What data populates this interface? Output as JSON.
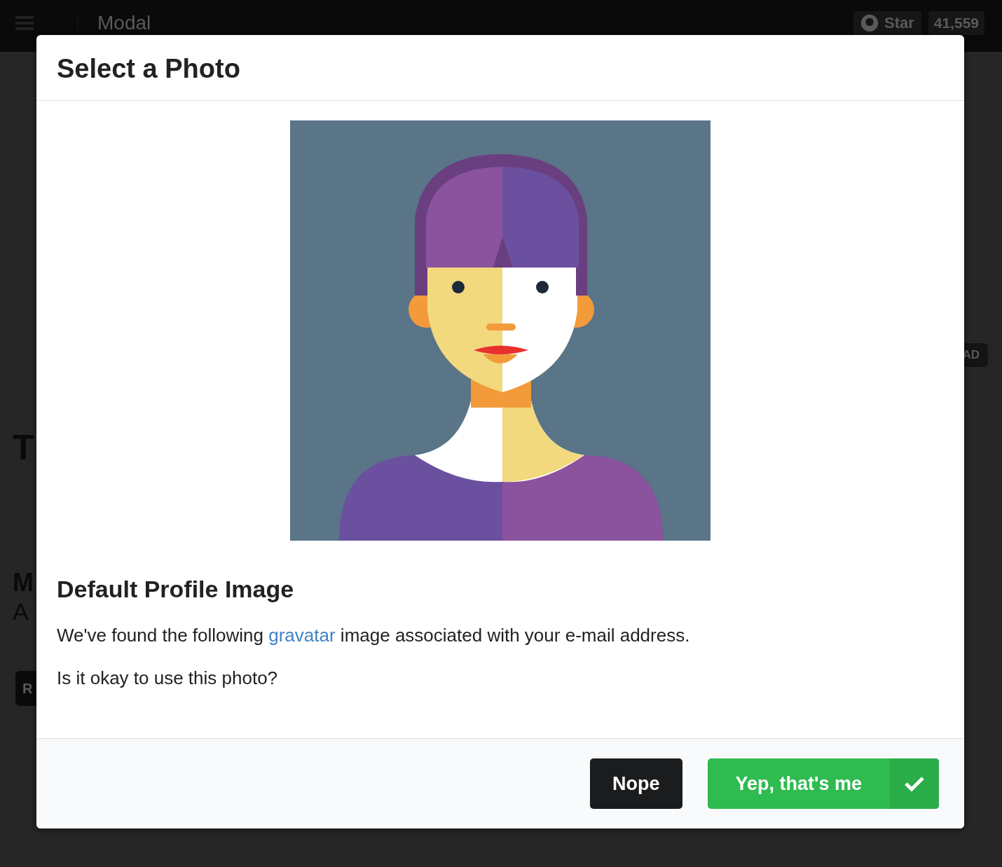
{
  "topbar": {
    "title": "Modal",
    "star_button": "Star",
    "star_count": "41,559"
  },
  "background": {
    "left_letters": [
      "T",
      "M",
      "A"
    ],
    "left_button": "R",
    "right_button": "AD"
  },
  "modal": {
    "title": "Select a Photo",
    "heading": "Default Profile Image",
    "description_before": "We've found the following",
    "link": "gravatar",
    "description_after": "image associated with your e-mail address.",
    "question": "Is it okay to use this photo?",
    "buttons": [
      {
        "label": "Nope",
        "kind": "secondary"
      },
      {
        "label": "Yep, that's me",
        "kind": "primary"
      }
    ]
  }
}
